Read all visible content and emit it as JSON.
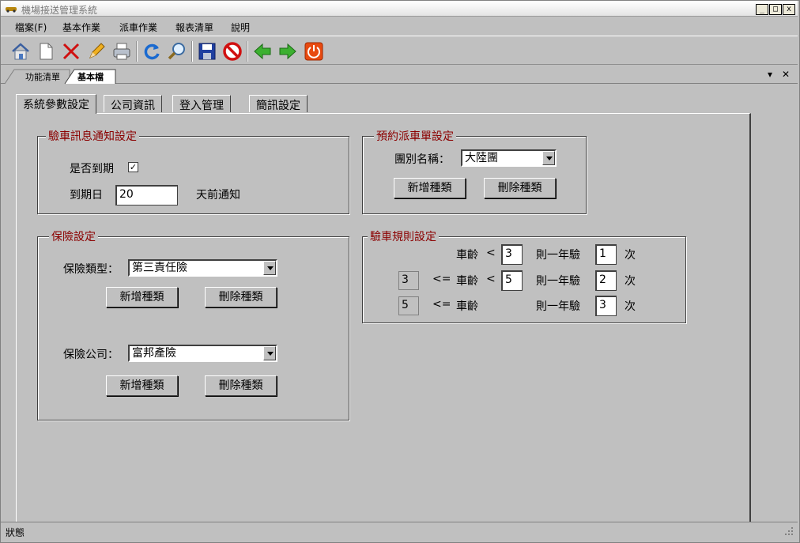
{
  "window": {
    "title": "機場接送管理系統",
    "min_symbol": "_",
    "max_symbol": "□",
    "close_symbol": "x"
  },
  "menu": [
    "檔案(F)",
    "基本作業",
    "派車作業",
    "報表清單",
    "說明"
  ],
  "toolbar": [
    "home-icon",
    "new-doc-icon",
    "delete-icon",
    "edit-icon",
    "print-icon",
    "refresh-icon",
    "search-icon",
    "save-icon",
    "cancel-icon",
    "prev-icon",
    "next-icon",
    "exit-icon"
  ],
  "doc_tabs": [
    "功能清單",
    "基本檔"
  ],
  "inner_tabs": [
    "系統參數設定",
    "公司資訊",
    "登入管理",
    "簡訊設定"
  ],
  "inspection_notice": {
    "title": "驗車訊息通知設定",
    "expire_label": "是否到期",
    "expire_checked": "✓",
    "days_label": "到期日",
    "days_value": "20",
    "days_suffix": "天前通知"
  },
  "reservation": {
    "title": "預約派車單設定",
    "group_label": "團別名稱：",
    "group_value": "大陸團",
    "add_button": "新增種類",
    "delete_button": "刪除種類"
  },
  "insurance": {
    "title": "保險設定",
    "type_label": "保險類型：",
    "type_value": "第三責任險",
    "type_add": "新增種類",
    "type_delete": "刪除種類",
    "company_label": "保險公司：",
    "company_value": "富邦產險",
    "company_add": "新增種類",
    "company_delete": "刪除種類"
  },
  "inspection_rules": {
    "title": "驗車規則設定",
    "age_label": "車齡",
    "lt": "<",
    "le": "<=",
    "per_year": "則一年驗",
    "times": "次",
    "row1": {
      "max_age": "3",
      "count": "1"
    },
    "row2": {
      "min_age": "3",
      "max_age": "5",
      "count": "2"
    },
    "row3": {
      "min_age": "5",
      "count": "3"
    }
  },
  "tab_controls": {
    "dropdown": "▾",
    "close": "✕"
  },
  "status": {
    "text": "狀態"
  }
}
